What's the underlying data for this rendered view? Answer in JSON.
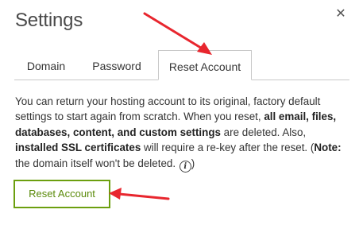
{
  "dialog": {
    "title": "Settings",
    "close_icon": "close-icon",
    "close_glyph": "✕"
  },
  "tabs": [
    {
      "label": "Domain",
      "active": false
    },
    {
      "label": "Password",
      "active": false
    },
    {
      "label": "Reset Account",
      "active": true
    }
  ],
  "content": {
    "p1": "You can return your hosting account to its original, factory default settings to start again from scratch. When you reset, ",
    "b1": "all email, files, databases, content, and custom settings",
    "p2": " are deleted. Also, ",
    "b2": "installed SSL certificates",
    "p3": " will require a re-key after the reset. (",
    "b3": "Note:",
    "p4": " the domain itself won't be deleted. ",
    "info_icon": "info-icon",
    "info_glyph": "i"
  },
  "reset_button": {
    "label": "Reset Account"
  },
  "annotation_color": "#e8262e",
  "accent_color": "#6c9f0f"
}
